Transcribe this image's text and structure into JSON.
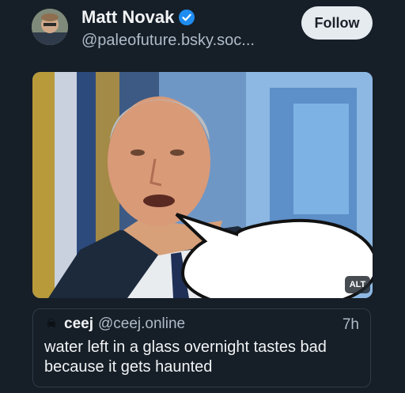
{
  "post": {
    "author": {
      "name": "Matt Novak",
      "handle": "@paleofuture.bsky.soc...",
      "verified": true,
      "avatar_icon": "avatar-photo"
    },
    "follow_label": "Follow",
    "media": {
      "image_icon": "photo-with-speech-bubble",
      "alt_label": "ALT"
    }
  },
  "quote": {
    "avatar_icon": "skull-crossbones",
    "name": "ceej",
    "handle": "@ceej.online",
    "time": "7h",
    "text": "water left in a glass overnight tastes bad because it gets haunted"
  },
  "colors": {
    "background": "#161e27",
    "primary_text": "#f1f3f5",
    "secondary_text": "#aebbc9",
    "verified_blue": "#1f8cf0",
    "follow_bg": "#e6ebf0"
  }
}
